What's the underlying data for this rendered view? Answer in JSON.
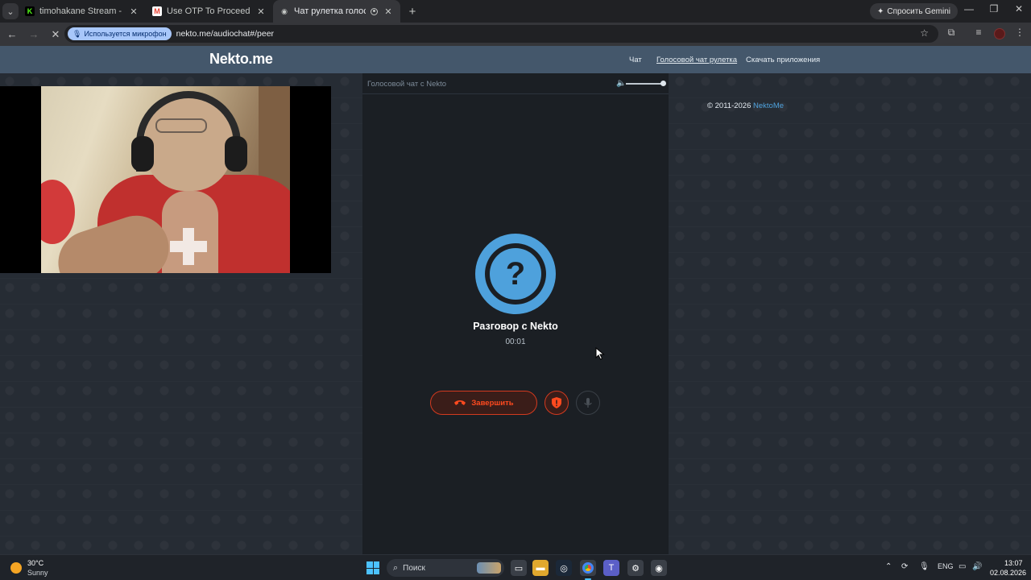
{
  "browser": {
    "tabs": [
      {
        "title": "timohakane Stream - Watch Live",
        "favicon": "K",
        "favicon_color": "#53fc18"
      },
      {
        "title": "Use OTP To Proceed - timohakane",
        "favicon": "M",
        "favicon_color": "#ea4335"
      },
      {
        "title": "Чат рулетка голосовая — Nekto",
        "favicon": "◉",
        "favicon_color": "#c4c7c5"
      }
    ],
    "gemini_label": "Спросить Gemini",
    "mic_indicator": "Используется микрофон",
    "url": "nekto.me/audiochat#/peer"
  },
  "site": {
    "logo": "Nekto.me",
    "nav": [
      "Чат",
      "Голосовой чат рулетка",
      "Скачать приложения"
    ],
    "panel_title": "Голосовой чат с Nekto",
    "avatar_symbol": "?",
    "talk_title": "Разговор с Nekto",
    "timer": "00:01",
    "end_label": "Завершить",
    "copyright_prefix": "© 2011-2026",
    "copyright_brand": "NektoMe",
    "accent_color": "#4ea1dc",
    "danger_color": "#d33a1f"
  },
  "taskbar": {
    "temperature": "30°C",
    "condition": "Sunny",
    "search_placeholder": "Поиск",
    "language": "ENG",
    "time": "13:07",
    "date": "02.08.2026"
  }
}
